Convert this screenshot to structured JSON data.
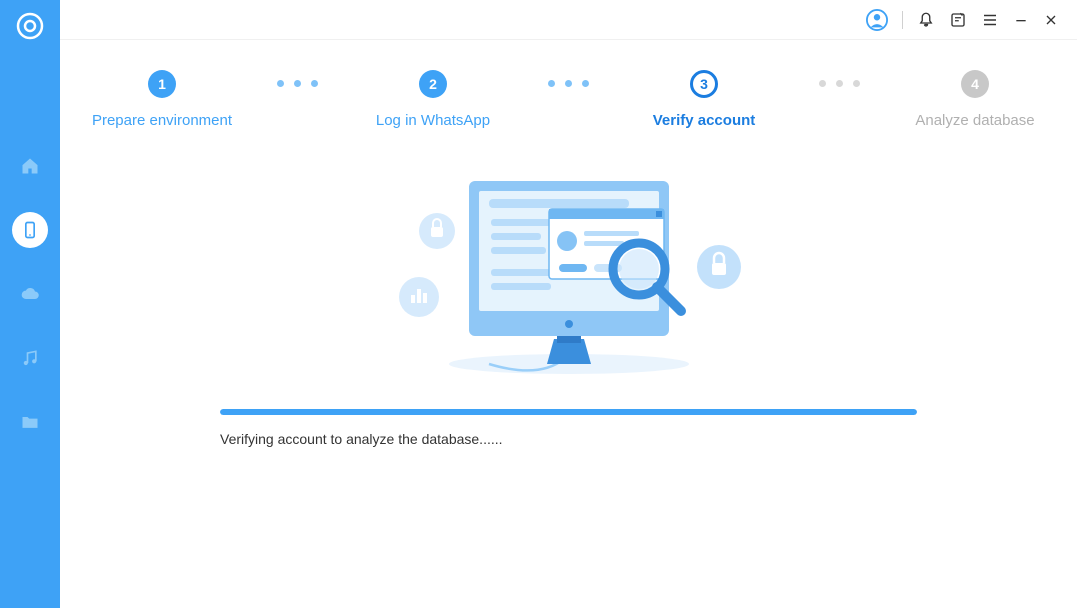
{
  "sidebar": {
    "items": [
      "home",
      "device",
      "cloud",
      "music",
      "folder"
    ],
    "active_index": 1
  },
  "steps": [
    {
      "num": "1",
      "label": "Prepare environment",
      "state": "completed"
    },
    {
      "num": "2",
      "label": "Log in WhatsApp",
      "state": "completed"
    },
    {
      "num": "3",
      "label": "Verify account",
      "state": "active"
    },
    {
      "num": "4",
      "label": "Analyze database",
      "state": "pending"
    }
  ],
  "status": {
    "text": "Verifying account to analyze the database......",
    "progress_pct": 100
  },
  "colors": {
    "primary": "#3EA2F6",
    "primary_dark": "#1B7DE0",
    "muted": "#C8C8C8"
  }
}
